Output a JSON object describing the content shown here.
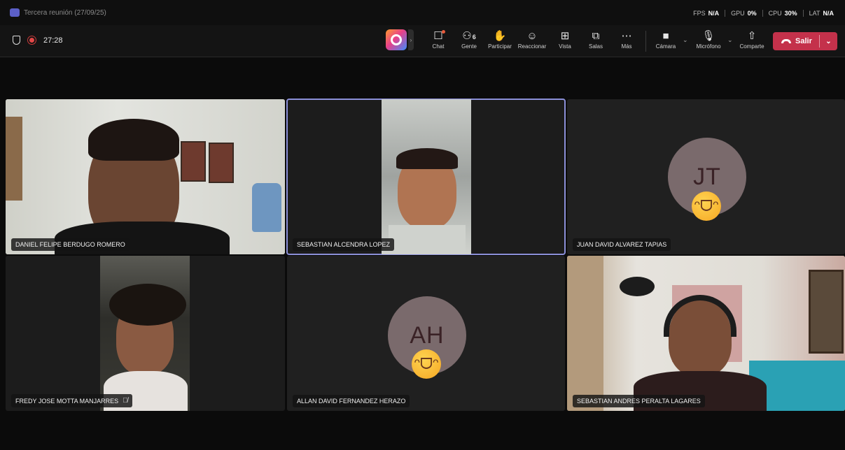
{
  "titlebar": {
    "title": "Tercera reunión (27/09/25)"
  },
  "perf": {
    "fps_label": "FPS",
    "fps_value": "N/A",
    "gpu_label": "GPU",
    "gpu_value": "0%",
    "cpu_label": "CPU",
    "cpu_value": "30%",
    "lat_label": "LAT",
    "lat_value": "N/A"
  },
  "meeting": {
    "timer": "27:28"
  },
  "toolbar": {
    "chat": "Chat",
    "people": "Gente",
    "people_count": "6",
    "raise": "Participar",
    "react": "Reaccionar",
    "view": "Vista",
    "rooms": "Salas",
    "more": "Más",
    "camera": "Cámara",
    "mic": "Micrófono",
    "share": "Comparte",
    "leave": "Salir"
  },
  "participants": [
    {
      "name": "DANIEL FELIPE BERDUGO ROMERO"
    },
    {
      "name": "SEBASTIAN ALCENDRA LOPEZ"
    },
    {
      "name": "JUAN DAVID ALVAREZ TAPIAS",
      "initials": "JT"
    },
    {
      "name": "FREDY JOSE MOTTA MANJARRES"
    },
    {
      "name": "ALLAN DAVID FERNANDEZ HERAZO",
      "initials": "AH"
    },
    {
      "name": "SEBASTIAN ANDRES PERALTA LAGARES"
    }
  ],
  "icons": {
    "reaction_emoji": "laughing-face",
    "accent": "#5b5fc7",
    "leave_color": "#c4314b",
    "active_speaker_color": "#8b8fd8"
  }
}
